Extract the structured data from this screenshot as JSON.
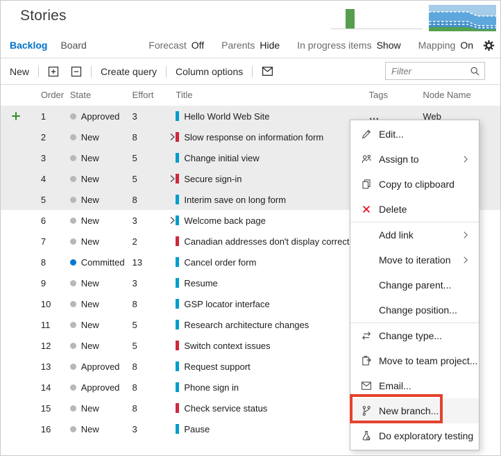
{
  "header": {
    "title": "Stories",
    "tabs": [
      {
        "label": "Backlog",
        "active": true
      },
      {
        "label": "Board",
        "active": false
      }
    ],
    "controls": [
      {
        "label": "Forecast",
        "value": "Off"
      },
      {
        "label": "Parents",
        "value": "Hide"
      },
      {
        "label": "In progress items",
        "value": "Show"
      },
      {
        "label": "Mapping",
        "value": "On"
      }
    ]
  },
  "toolbar": {
    "new_label": "New",
    "create_query_label": "Create query",
    "column_options_label": "Column options",
    "filter_placeholder": "Filter"
  },
  "table": {
    "columns": [
      "Order",
      "State",
      "Effort",
      "Title",
      "Tags",
      "Node Name"
    ],
    "rows": [
      {
        "order": "1",
        "state": "Approved",
        "effort": "3",
        "type": "story",
        "expandable": false,
        "title": "Hello World Web Site",
        "menu_trigger": "…",
        "node": "Web",
        "shaded": true,
        "selected": true
      },
      {
        "order": "2",
        "state": "New",
        "effort": "8",
        "type": "bug",
        "expandable": true,
        "title": "Slow response on information form",
        "shaded": true
      },
      {
        "order": "3",
        "state": "New",
        "effort": "5",
        "type": "story",
        "expandable": false,
        "title": "Change initial view",
        "shaded": true
      },
      {
        "order": "4",
        "state": "New",
        "effort": "5",
        "type": "bug",
        "expandable": true,
        "title": "Secure sign-in",
        "shaded": true
      },
      {
        "order": "5",
        "state": "New",
        "effort": "8",
        "type": "story",
        "expandable": false,
        "title": "Interim save on long form",
        "shaded": true
      },
      {
        "order": "6",
        "state": "New",
        "effort": "3",
        "type": "story",
        "expandable": true,
        "title": "Welcome back page"
      },
      {
        "order": "7",
        "state": "New",
        "effort": "2",
        "type": "bug",
        "expandable": false,
        "title": "Canadian addresses don't display correctly"
      },
      {
        "order": "8",
        "state": "Committed",
        "effort": "13",
        "type": "story",
        "expandable": false,
        "title": "Cancel order form"
      },
      {
        "order": "9",
        "state": "New",
        "effort": "3",
        "type": "story",
        "expandable": false,
        "title": "Resume"
      },
      {
        "order": "10",
        "state": "New",
        "effort": "8",
        "type": "story",
        "expandable": false,
        "title": "GSP locator interface"
      },
      {
        "order": "11",
        "state": "New",
        "effort": "5",
        "type": "story",
        "expandable": false,
        "title": "Research architecture changes"
      },
      {
        "order": "12",
        "state": "New",
        "effort": "5",
        "type": "bug",
        "expandable": false,
        "title": "Switch context issues"
      },
      {
        "order": "13",
        "state": "Approved",
        "effort": "8",
        "type": "story",
        "expandable": false,
        "title": "Request support"
      },
      {
        "order": "14",
        "state": "Approved",
        "effort": "8",
        "type": "story",
        "expandable": false,
        "title": "Phone sign in"
      },
      {
        "order": "15",
        "state": "New",
        "effort": "8",
        "type": "bug",
        "expandable": false,
        "title": "Check service status"
      },
      {
        "order": "16",
        "state": "New",
        "effort": "3",
        "type": "story",
        "expandable": false,
        "title": "Pause"
      }
    ]
  },
  "menu": {
    "items": [
      {
        "label": "Edit...",
        "icon": "pencil-icon"
      },
      {
        "label": "Assign to",
        "icon": "person-icon",
        "submenu": true
      },
      {
        "label": "Copy to clipboard",
        "icon": "copy-icon"
      },
      {
        "label": "Delete",
        "icon": "delete-icon",
        "divider": true
      },
      {
        "label": "Add link",
        "submenu": true
      },
      {
        "label": "Move to iteration",
        "submenu": true
      },
      {
        "label": "Change parent..."
      },
      {
        "label": "Change position...",
        "divider": true
      },
      {
        "label": "Change type...",
        "icon": "swap-icon"
      },
      {
        "label": "Move to team project...",
        "icon": "clipboard-arrow-icon"
      },
      {
        "label": "Email...",
        "icon": "envelope-icon"
      },
      {
        "label": "New branch...",
        "icon": "branch-icon",
        "highlighted": true
      },
      {
        "label": "Do exploratory testing",
        "icon": "flask-icon"
      }
    ]
  },
  "colors": {
    "accent_blue": "#0072C6",
    "story_bar": "#009CCC",
    "bug_bar": "#CC293D",
    "committed_dot": "#0078D4",
    "new_dot": "#B8B8B8",
    "green_plus": "#2E8F2E",
    "highlight_red": "#E3432E",
    "velocity_green": "#569E4D",
    "cfd_light": "#A5CCE9",
    "cfd_mid": "#5EA7DC",
    "cfd_dark": "#418FCB",
    "cfd_green": "#55A04E"
  }
}
